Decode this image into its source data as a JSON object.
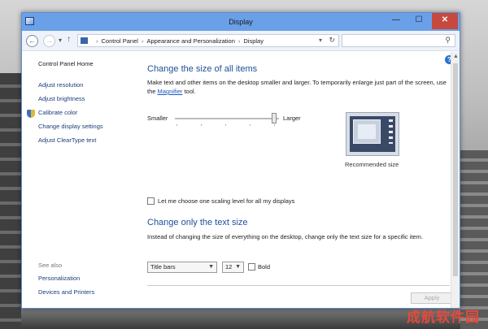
{
  "window": {
    "title": "Display",
    "minimize_glyph": "—",
    "maximize_glyph": "☐",
    "close_glyph": "✕"
  },
  "navbar": {
    "back_glyph": "←",
    "forward_glyph": "→",
    "dropdown_glyph": "▾",
    "up_glyph": "↑",
    "breadcrumbs": [
      "Control Panel",
      "Appearance and Personalization",
      "Display"
    ],
    "address_chevron": "▾",
    "refresh_glyph": "↻",
    "search_placeholder": "",
    "search_glyph": "⚲"
  },
  "sidebar": {
    "home": "Control Panel Home",
    "items": [
      "Adjust resolution",
      "Adjust brightness",
      "Calibrate color",
      "Change display settings",
      "Adjust ClearType text"
    ],
    "see_also_heading": "See also",
    "see_also": [
      "Personalization",
      "Devices and Printers"
    ]
  },
  "main": {
    "help_glyph": "?",
    "section1": {
      "title": "Change the size of all items",
      "desc_part1": "Make text and other items on the desktop smaller and larger. To temporarily enlarge just part of the screen, use the ",
      "desc_link": "Magnifier",
      "desc_part2": " tool."
    },
    "slider": {
      "smaller_label": "Smaller",
      "larger_label": "Larger",
      "value_fraction": 0.95
    },
    "preview_caption": "Recommended size",
    "scaling_checkbox_label": "Let me choose one scaling level for all my displays",
    "scaling_checked": false,
    "section2": {
      "title": "Change only the text size",
      "desc": "Instead of changing the size of everything on the desktop, change only the text size for a specific item."
    },
    "text_item_select": "Title bars",
    "text_size_select": "12",
    "bold_label": "Bold",
    "bold_checked": false,
    "apply_label": "Apply"
  },
  "scrollbar": {
    "up_glyph": "▲"
  },
  "watermark": "成航软件园"
}
